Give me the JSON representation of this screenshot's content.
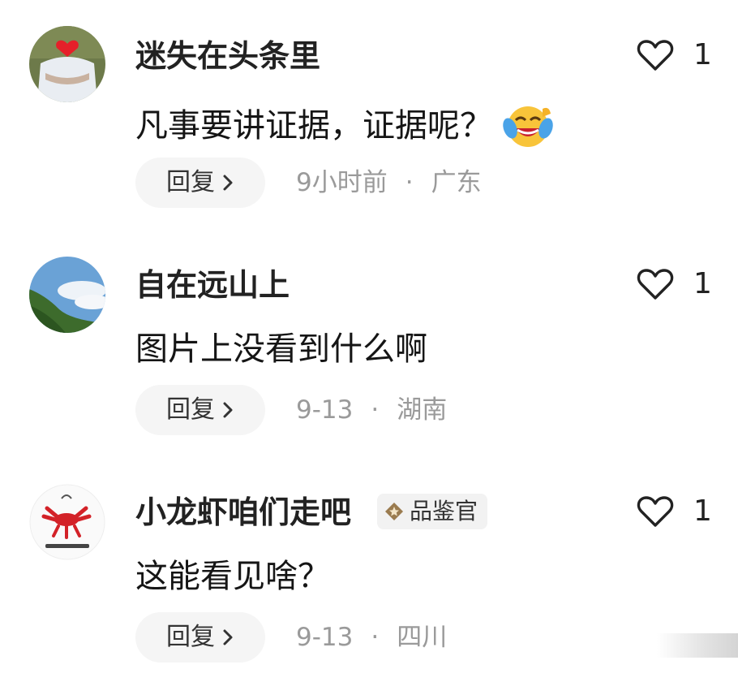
{
  "comments": [
    {
      "username": "迷失在头条里",
      "text": "凡事要讲证据，证据呢？",
      "emoji": "laugh-cry-emoji",
      "reply_label": "回复",
      "time": "9小时前",
      "separator": "·",
      "location": "广东",
      "like_count": "1",
      "avatar": "avatar-heart-shirt"
    },
    {
      "username": "自在远山上",
      "text": "图片上没看到什么啊",
      "reply_label": "回复",
      "time": "9-13",
      "separator": "·",
      "location": "湖南",
      "like_count": "1",
      "avatar": "avatar-mountain-sky"
    },
    {
      "username": "小龙虾咱们走吧",
      "badge": "品鉴官",
      "text": "这能看见啥？",
      "reply_label": "回复",
      "time": "9-13",
      "separator": "·",
      "location": "四川",
      "like_count": "1",
      "avatar": "avatar-crayfish-logo"
    }
  ],
  "colors": {
    "meta_gray": "#9a9a9a",
    "reply_bg": "#f5f5f5",
    "badge_bg": "#f2f2f2",
    "badge_icon": "#9a7b4f"
  }
}
